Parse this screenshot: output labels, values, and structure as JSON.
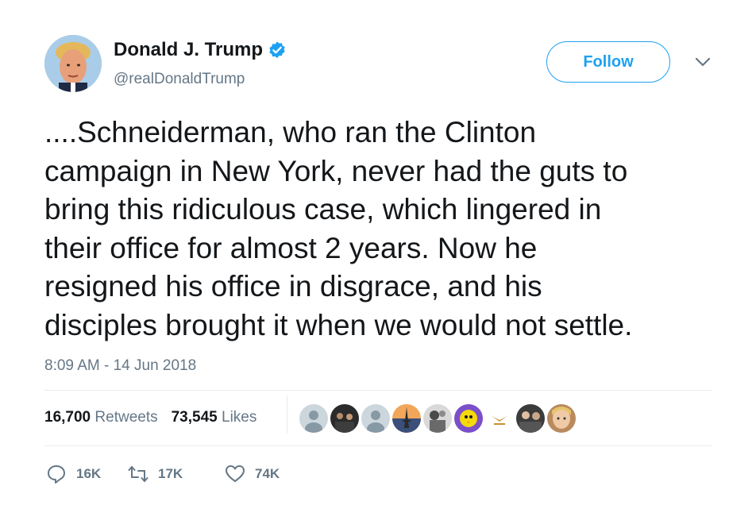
{
  "user": {
    "display_name": "Donald J. Trump",
    "handle": "@realDonaldTrump",
    "verified": true
  },
  "follow_label": "Follow",
  "tweet": {
    "text": "....Schneiderman, who ran the Clinton\ncampaign in New York, never had the guts to\nbring this ridiculous case, which lingered in\ntheir office for almost 2 years. Now he\nresigned his office in disgrace, and his\ndisciples brought it when we would not settle.",
    "timestamp": "8:09 AM - 14 Jun 2018"
  },
  "stats": {
    "retweets_count": "16,700",
    "retweets_label": "Retweets",
    "likes_count": "73,545",
    "likes_label": "Likes"
  },
  "actions": {
    "reply_count": "16K",
    "retweet_count": "17K",
    "like_count": "74K"
  },
  "colors": {
    "accent": "#1da1f2",
    "secondary_text": "#657786",
    "primary_text": "#14171a",
    "divider": "#e6ecf0"
  }
}
